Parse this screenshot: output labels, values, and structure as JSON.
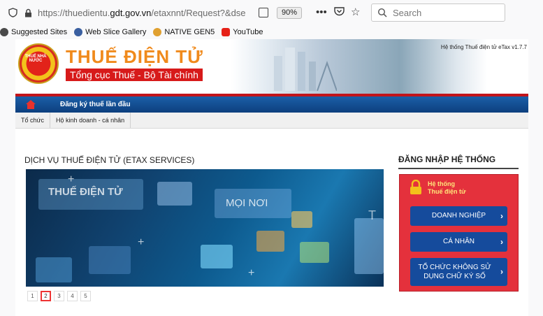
{
  "browser": {
    "url_prefix": "https://thuedientu.",
    "url_domain": "gdt.gov.vn",
    "url_path": "/etaxnnt/Request?&dse",
    "zoom": "90%",
    "search_placeholder": "Search",
    "bookmarks": [
      {
        "label": "Suggested Sites",
        "icon": "gear-icon",
        "color": "#4a4a4a"
      },
      {
        "label": "Web Slice Gallery",
        "icon": "globe-icon",
        "color": "#3a5fa0"
      },
      {
        "label": "NATIVE GEN5",
        "icon": "native-icon",
        "color": "#e0a030"
      },
      {
        "label": "YouTube",
        "icon": "youtube-icon",
        "color": "#e62117"
      }
    ]
  },
  "header": {
    "emblem_text": "THUẾ NHÀ NƯỚC",
    "brand_title": "THUẾ ĐIỆN TỬ",
    "brand_subtitle": "Tổng cục Thuế - Bộ Tài chính",
    "version": "Hệ thống Thuế điện tử eTax v1.7.7"
  },
  "nav": {
    "register_label": "Đăng ký thuế lần đầu",
    "subnav": [
      "Tổ chức",
      "Hộ kinh doanh - cá nhân"
    ]
  },
  "main": {
    "section_title": "DỊCH VỤ THUẾ ĐIỆN TỬ (ETAX SERVICES)",
    "hero_texts": [
      "THUẾ ĐIỆN TỬ",
      "MỌI NƠI",
      "T"
    ],
    "pages": [
      "1",
      "2",
      "3",
      "4",
      "5"
    ],
    "active_page": "2"
  },
  "login": {
    "title": "ĐĂNG NHẬP HỆ THỐNG",
    "system_label_1": "Hệ thống",
    "system_label_2": "Thuế điện tử",
    "buttons": [
      "DOANH NGHIỆP",
      "CÁ NHÂN",
      "TỔ CHỨC KHÔNG SỬ DỤNG CHỮ KÝ SỐ"
    ]
  },
  "colors": {
    "nav_blue": "#154b9c",
    "accent_red": "#c2141a",
    "login_red": "#e4313c",
    "brand_orange": "#f08a1c"
  }
}
